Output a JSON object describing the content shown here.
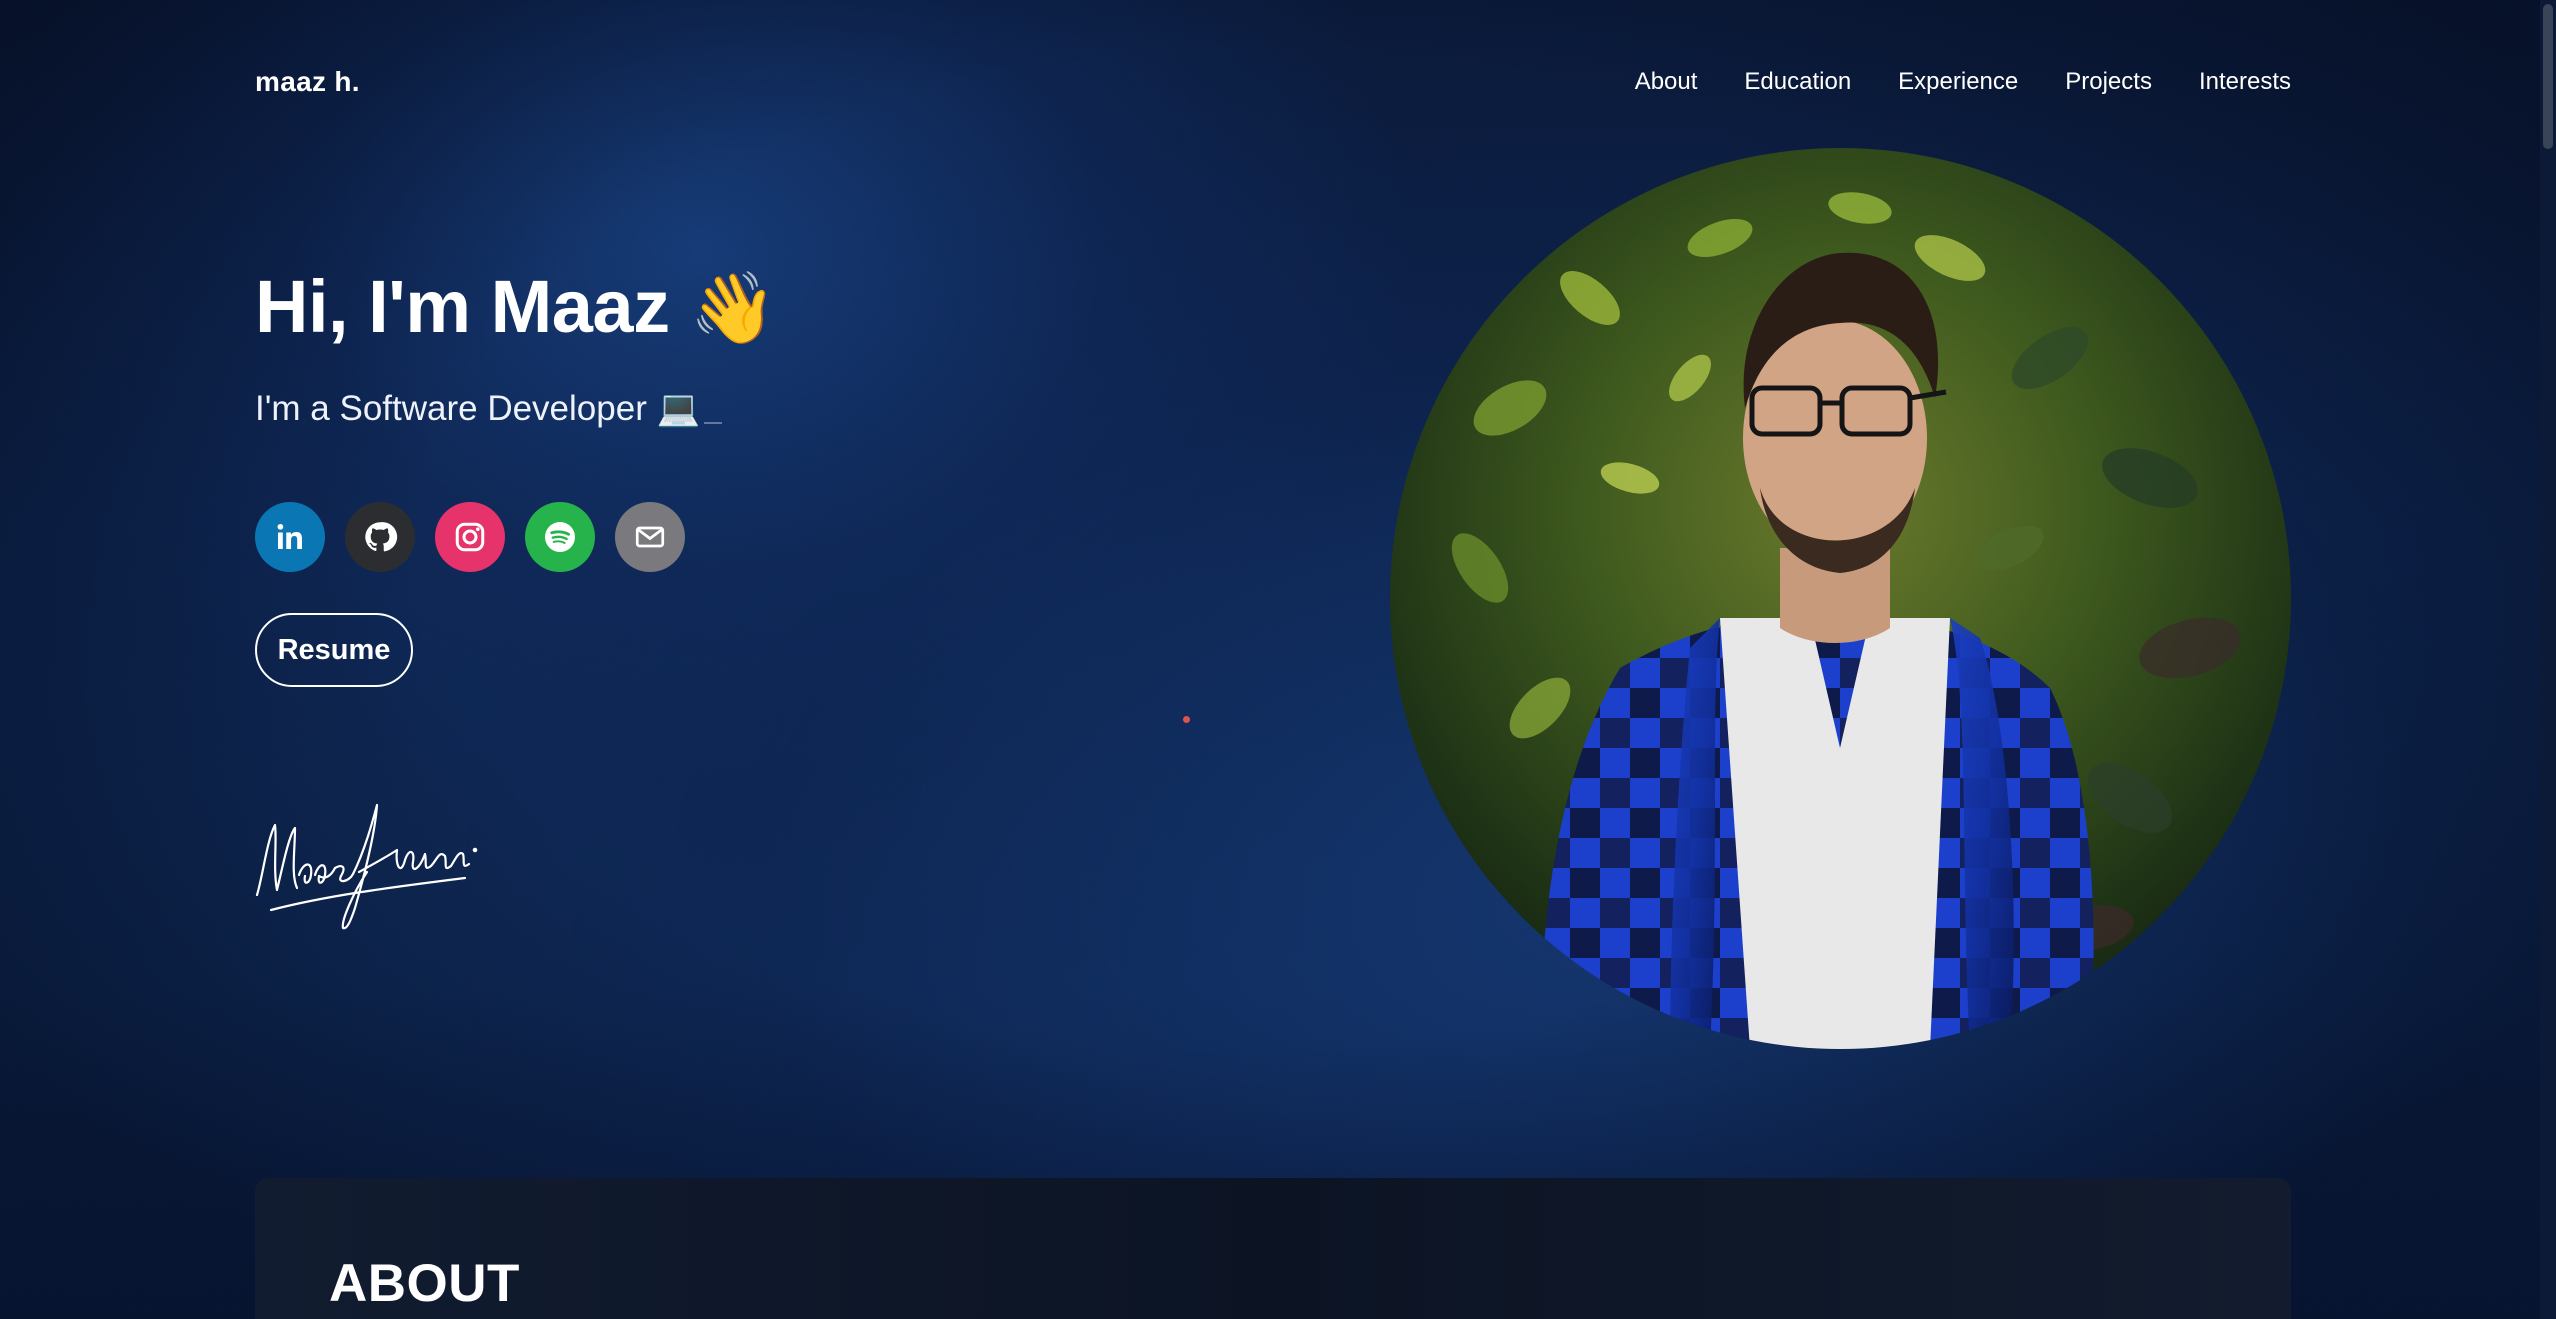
{
  "nav": {
    "brand": "maaz h.",
    "links": [
      "About",
      "Education",
      "Experience",
      "Projects",
      "Interests"
    ]
  },
  "hero": {
    "title": "Hi, I'm Maaz",
    "title_emoji": "👋",
    "subtitle": "I'm a Software Developer",
    "subtitle_emoji": "💻",
    "resume_label": "Resume"
  },
  "socials": [
    {
      "name": "linkedin-icon",
      "color": "#0a76b4"
    },
    {
      "name": "github-icon",
      "color": "#2b2d31"
    },
    {
      "name": "instagram-icon",
      "color": "#e6336b"
    },
    {
      "name": "spotify-icon",
      "color": "#27b34b"
    },
    {
      "name": "mail-icon",
      "color": "#7a7a7e"
    }
  ],
  "about": {
    "heading": "ABOUT"
  },
  "colors": {
    "background": "#0e2550",
    "accent_dot": "#e0524f",
    "card": "#0c1424"
  }
}
